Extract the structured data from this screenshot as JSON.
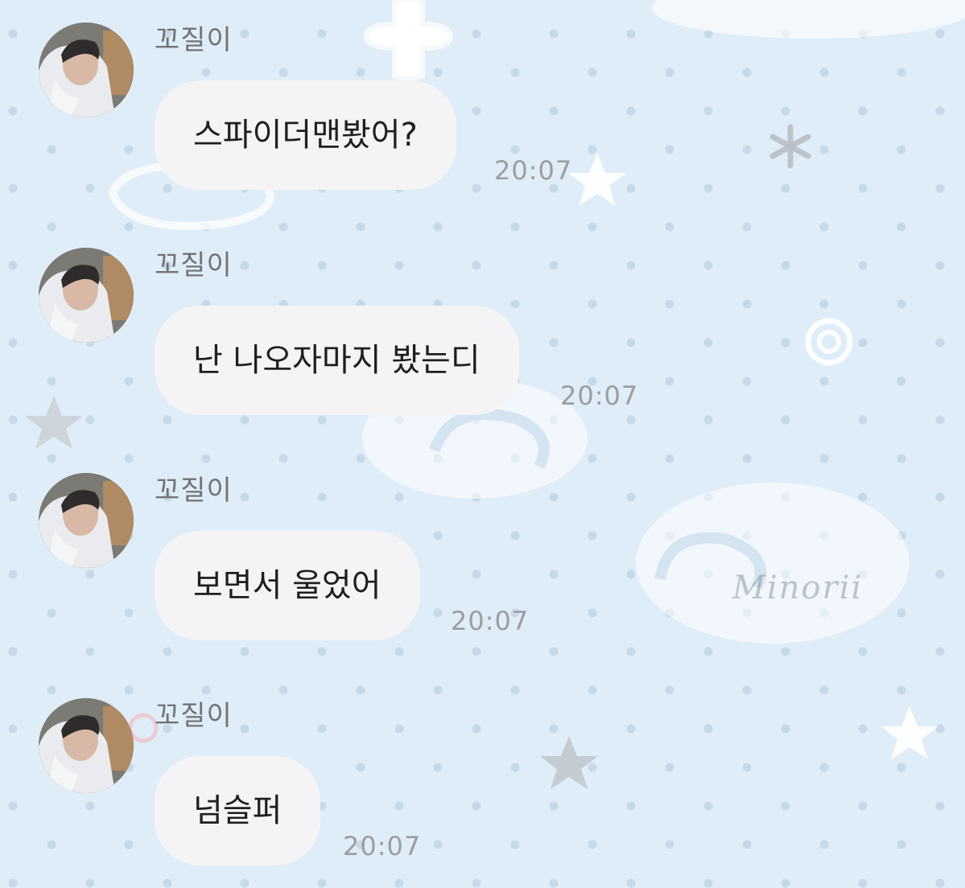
{
  "chat": {
    "messages": [
      {
        "sender": "꼬질이",
        "text": "스파이더맨봤어?",
        "time": "20:07"
      },
      {
        "sender": "꼬질이",
        "text": "난 나오자마지 봤는디",
        "time": "20:07"
      },
      {
        "sender": "꼬질이",
        "text": "보면서 울었어",
        "time": "20:07"
      },
      {
        "sender": "꼬질이",
        "text": "넘슬퍼",
        "time": "20:07"
      }
    ]
  },
  "wallpaper": {
    "signature": "Minorii",
    "background_color": "#dfedf8",
    "dot_color": "#b0c8da",
    "bubble_color": "#f4f4f6"
  }
}
